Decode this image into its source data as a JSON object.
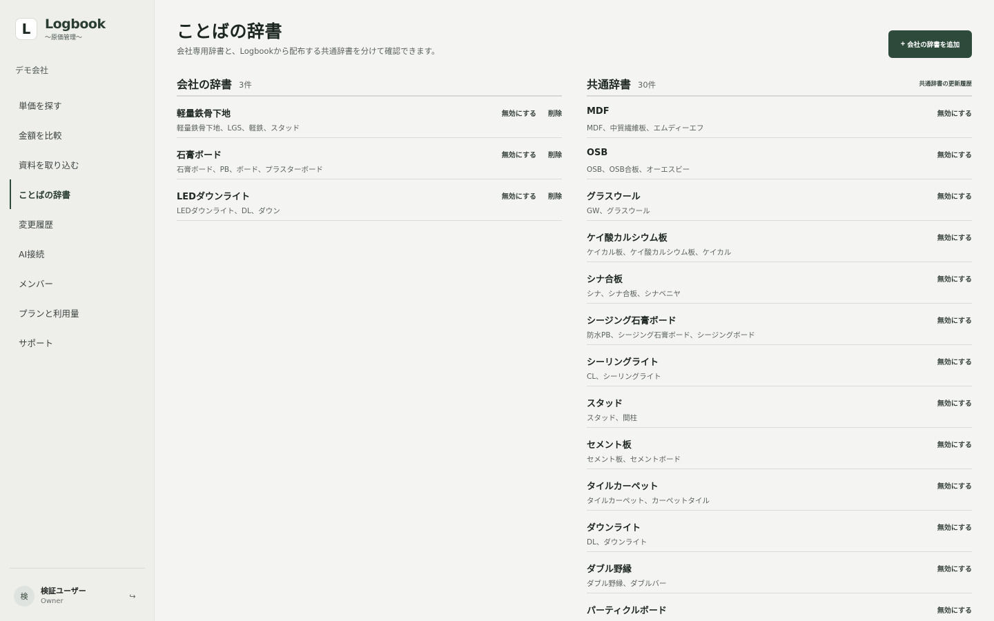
{
  "app": {
    "logo_letter": "L",
    "name": "Logbook",
    "subtitle": "〜原価管理〜",
    "org": "デモ会社"
  },
  "nav": [
    {
      "label": "単価を探す",
      "active": false
    },
    {
      "label": "金額を比較",
      "active": false
    },
    {
      "label": "資料を取り込む",
      "active": false
    },
    {
      "label": "ことばの辞書",
      "active": true
    },
    {
      "label": "変更履歴",
      "active": false
    },
    {
      "label": "AI接続",
      "active": false
    },
    {
      "label": "メンバー",
      "active": false
    },
    {
      "label": "プランと利用量",
      "active": false
    },
    {
      "label": "サポート",
      "active": false
    }
  ],
  "user": {
    "avatar": "検",
    "name": "検証ユーザー",
    "role": "Owner",
    "logout_icon": "↪"
  },
  "page": {
    "title": "ことばの辞書",
    "subtitle": "会社専用辞書と、Logbookから配布する共通辞書を分けて確認できます。",
    "add_button": "会社の辞書を追加",
    "add_icon": "+"
  },
  "company_dict": {
    "title": "会社の辞書",
    "count": "3件",
    "disable_label": "無効にする",
    "delete_label": "削除",
    "entries": [
      {
        "name": "軽量鉄骨下地",
        "aliases": "軽量鉄骨下地、LGS、軽鉄、スタッド"
      },
      {
        "name": "石膏ボード",
        "aliases": "石膏ボード、PB、ボード、プラスターボード"
      },
      {
        "name": "LEDダウンライト",
        "aliases": "LEDダウンライト、DL、ダウン"
      }
    ]
  },
  "common_dict": {
    "title": "共通辞書",
    "count": "30件",
    "history_link": "共通辞書の更新履歴",
    "disable_label": "無効にする",
    "entries": [
      {
        "name": "MDF",
        "aliases": "MDF、中質繊維板、エムディーエフ"
      },
      {
        "name": "OSB",
        "aliases": "OSB、OSB合板、オーエスビー"
      },
      {
        "name": "グラスウール",
        "aliases": "GW、グラスウール"
      },
      {
        "name": "ケイ酸カルシウム板",
        "aliases": "ケイカル板、ケイ酸カルシウム板、ケイカル"
      },
      {
        "name": "シナ合板",
        "aliases": "シナ、シナ合板、シナベニヤ"
      },
      {
        "name": "シージング石膏ボード",
        "aliases": "防水PB、シージング石膏ボード、シージングボード"
      },
      {
        "name": "シーリングライト",
        "aliases": "CL、シーリングライト"
      },
      {
        "name": "スタッド",
        "aliases": "スタッド、間柱"
      },
      {
        "name": "セメント板",
        "aliases": "セメント板、セメントボード"
      },
      {
        "name": "タイルカーペット",
        "aliases": "タイルカーペット、カーペットタイル"
      },
      {
        "name": "ダウンライト",
        "aliases": "DL、ダウンライト"
      },
      {
        "name": "ダブル野縁",
        "aliases": "ダブル野縁、ダブルバー"
      },
      {
        "name": "パーティクルボード",
        "aliases": ""
      }
    ]
  }
}
